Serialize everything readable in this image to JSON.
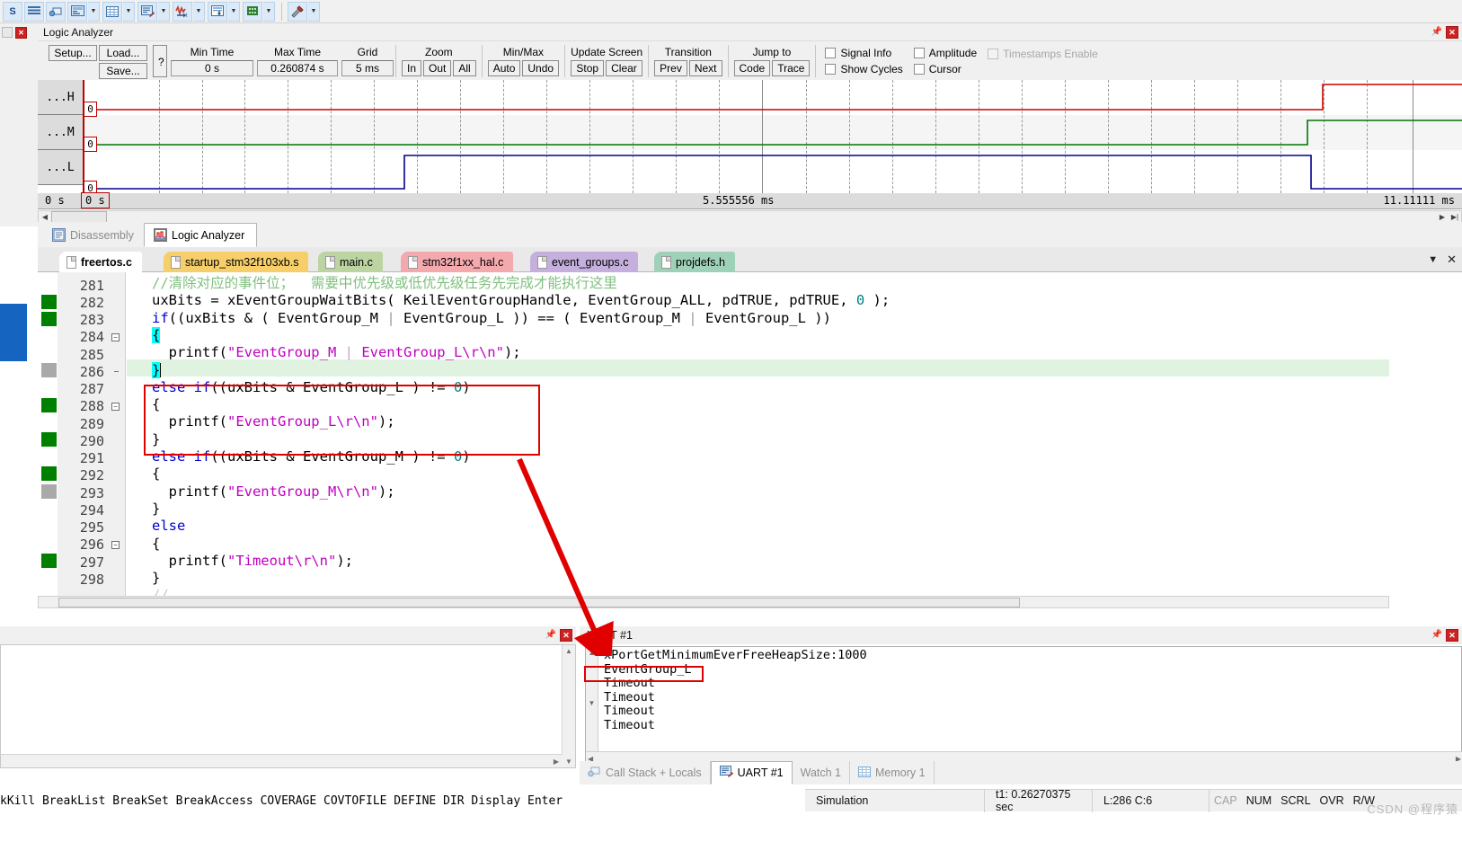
{
  "toolbar": {
    "icons": [
      "debug-step-icon",
      "memory-map-icon",
      "call-stack-icon",
      "watch-window-icon",
      "memory-window-icon",
      "serial-window-icon",
      "trace-icon",
      "analysis-window-icon",
      "system-viewer-icon",
      "tools-icon"
    ],
    "labels": [
      "S",
      "≡",
      "⧉",
      "▦",
      "▦",
      "✎",
      "⥈",
      "▤",
      "▣",
      "⚒"
    ]
  },
  "logic_analyzer": {
    "title": "Logic Analyzer",
    "buttons": {
      "setup": "Setup...",
      "load": "Load...",
      "save": "Save...",
      "help": "?"
    },
    "fields": [
      {
        "label": "Min Time",
        "value": "0 s"
      },
      {
        "label": "Max Time",
        "value": "0.260874 s"
      },
      {
        "label": "Grid",
        "value": "5 ms"
      }
    ],
    "groups": [
      {
        "label": "Zoom",
        "buttons": [
          "In",
          "Out",
          "All"
        ]
      },
      {
        "label": "Min/Max",
        "buttons": [
          "Auto",
          "Undo"
        ]
      },
      {
        "label": "Update Screen",
        "buttons": [
          "Stop",
          "Clear"
        ]
      },
      {
        "label": "Transition",
        "buttons": [
          "Prev",
          "Next"
        ]
      },
      {
        "label": "Jump to",
        "buttons": [
          "Code",
          "Trace"
        ]
      }
    ],
    "checkboxes": [
      {
        "label": "Signal Info",
        "checked": false,
        "disabled": false
      },
      {
        "label": "Show Cycles",
        "checked": false,
        "disabled": false
      },
      {
        "label": "Amplitude",
        "checked": false,
        "disabled": false
      },
      {
        "label": "Cursor",
        "checked": false,
        "disabled": false
      },
      {
        "label": "Timestamps Enable",
        "checked": false,
        "disabled": true
      }
    ],
    "signals": [
      {
        "name": "...H",
        "value_label": "0",
        "color": "#cc0000"
      },
      {
        "name": "...M",
        "value_label": "0",
        "color": "#007700"
      },
      {
        "name": "...L",
        "value_label": "0",
        "color": "#00008b"
      }
    ],
    "axis": {
      "start": "0 s",
      "cursor_box": "0 s",
      "mid": "5.555556 ms",
      "end": "11.11111 ms"
    }
  },
  "view_tabs": [
    {
      "label": "Disassembly",
      "icon": "disassembly-icon",
      "active": false
    },
    {
      "label": "Logic Analyzer",
      "icon": "logic-analyzer-icon",
      "active": true
    }
  ],
  "file_tabs": [
    {
      "label": "freertos.c",
      "color": "#ffffff",
      "active": true
    },
    {
      "label": "startup_stm32f103xb.s",
      "color": "#f6cf6a",
      "active": false
    },
    {
      "label": "main.c",
      "color": "#bcd3a2",
      "active": false
    },
    {
      "label": "stm32f1xx_hal.c",
      "color": "#f3a9ae",
      "active": false
    },
    {
      "label": "event_groups.c",
      "color": "#c5b0dd",
      "active": false
    },
    {
      "label": "projdefs.h",
      "color": "#9fd1b8",
      "active": false
    }
  ],
  "editor": {
    "first_line": 281,
    "highlighted_line": 286,
    "lines": [
      {
        "n": 281,
        "mark": "none",
        "fold": false,
        "text": "   //清除对应的事件位；  需要中优先级或低优先级任务先完成才能执行这里"
      },
      {
        "n": 282,
        "mark": "green",
        "fold": false,
        "text": "   uxBits = xEventGroupWaitBits( KeilEventGroupHandle, EventGroup_ALL, pdTRUE, pdTRUE, 0 );"
      },
      {
        "n": 283,
        "mark": "green",
        "fold": false,
        "text": "   if((uxBits & ( EventGroup_M | EventGroup_L )) == ( EventGroup_M | EventGroup_L ))"
      },
      {
        "n": 284,
        "mark": "none",
        "fold": true,
        "text": "   {"
      },
      {
        "n": 285,
        "mark": "gray",
        "fold": false,
        "text": "     printf(\"EventGroup_M | EventGroup_L\\r\\n\");"
      },
      {
        "n": 286,
        "mark": "none",
        "fold": false,
        "text": "   }"
      },
      {
        "n": 287,
        "mark": "green",
        "fold": false,
        "text": "   else if((uxBits & EventGroup_L ) != 0)"
      },
      {
        "n": 288,
        "mark": "none",
        "fold": true,
        "text": "   {"
      },
      {
        "n": 289,
        "mark": "green",
        "fold": false,
        "text": "     printf(\"EventGroup_L\\r\\n\");"
      },
      {
        "n": 290,
        "mark": "none",
        "fold": false,
        "text": "   }"
      },
      {
        "n": 291,
        "mark": "green",
        "fold": false,
        "text": "   else if((uxBits & EventGroup_M ) != 0)"
      },
      {
        "n": 292,
        "mark": "none",
        "fold": false,
        "text": "   {"
      },
      {
        "n": 293,
        "mark": "gray",
        "fold": false,
        "text": "     printf(\"EventGroup_M\\r\\n\");"
      },
      {
        "n": 294,
        "mark": "none",
        "fold": false,
        "text": "   }"
      },
      {
        "n": 295,
        "mark": "none",
        "fold": false,
        "text": "   else"
      },
      {
        "n": 296,
        "mark": "none",
        "fold": true,
        "text": "   {"
      },
      {
        "n": 297,
        "mark": "green",
        "fold": false,
        "text": "     printf(\"Timeout\\r\\n\");"
      },
      {
        "n": 298,
        "mark": "none",
        "fold": false,
        "text": "   }"
      }
    ]
  },
  "uart": {
    "title": "UART #1",
    "lines": [
      "xPortGetMinimumEverFreeHeapSize:1000",
      "EventGroup_L",
      "Timeout",
      "Timeout",
      "Timeout",
      "Timeout"
    ],
    "highlighted_line_index": 1
  },
  "command_line": "kKill BreakList BreakSet BreakAccess COVERAGE COVTOFILE DEFINE DIR Display Enter",
  "bottom_tabs": [
    {
      "label": "Call Stack + Locals",
      "icon": "call-stack-icon",
      "active": false
    },
    {
      "label": "UART #1",
      "icon": "serial-window-icon",
      "active": true
    },
    {
      "label": "Watch 1",
      "icon": "",
      "active": false
    },
    {
      "label": "Memory 1",
      "icon": "memory-icon",
      "active": false
    }
  ],
  "status_bar": {
    "mode": "Simulation",
    "time": "t1: 0.26270375 sec",
    "position": "L:286 C:6",
    "indicators": [
      "CAP",
      "NUM",
      "SCRL",
      "OVR",
      "R/W"
    ]
  },
  "watermark": "CSDN @程序猿",
  "colors": {
    "signal_h": "#cc0000",
    "signal_m": "#007700",
    "signal_l": "#00008b",
    "annotation": "#e00000",
    "highlight_line": "#dff3e0",
    "accent": "#0f6ecd"
  }
}
